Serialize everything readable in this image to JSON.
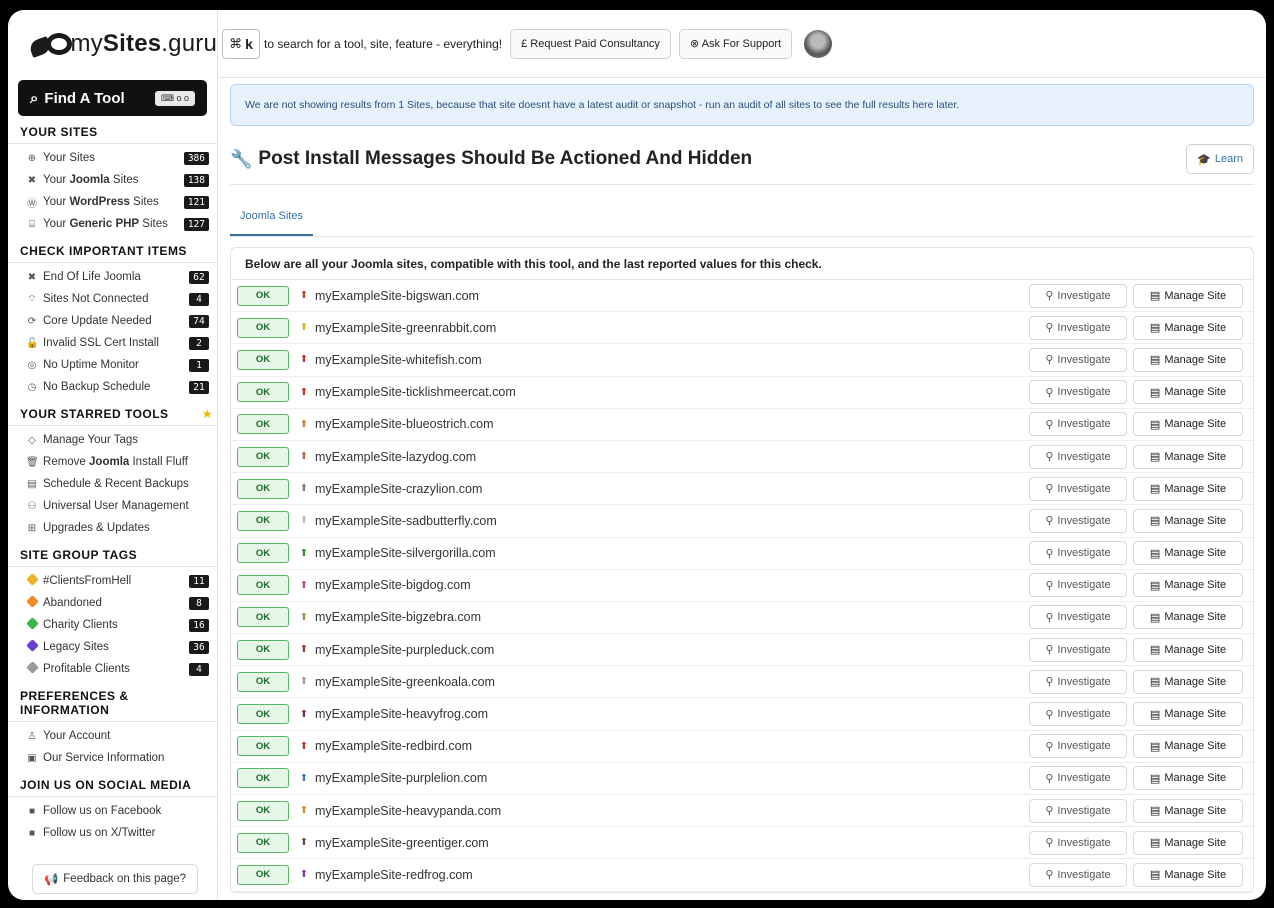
{
  "brand": {
    "name_prefix": "my",
    "name_bold": "Sites",
    "name_suffix": ".guru"
  },
  "sidebar": {
    "find_tool": {
      "label": "Find A Tool",
      "shortcut": "⌨ o o"
    },
    "sections": [
      {
        "title": "YOUR SITES",
        "items": [
          {
            "icon": "globe-icon",
            "glyph": "⊕",
            "pre": "Your Sites",
            "bold": "",
            "post": "",
            "count": "386"
          },
          {
            "icon": "joomla-icon",
            "glyph": "✖",
            "pre": "Your ",
            "bold": "Joomla",
            "post": " Sites",
            "count": "138"
          },
          {
            "icon": "wordpress-icon",
            "glyph": "Ⓦ",
            "pre": "Your ",
            "bold": "WordPress",
            "post": " Sites",
            "count": "121"
          },
          {
            "icon": "php-icon",
            "glyph": "⌸",
            "pre": "Your ",
            "bold": "Generic PHP",
            "post": " Sites",
            "count": "127"
          }
        ]
      },
      {
        "title": "CHECK IMPORTANT ITEMS",
        "items": [
          {
            "icon": "joomla-icon",
            "glyph": "✖",
            "pre": "End Of Life Joomla",
            "bold": "",
            "post": "",
            "count": "62"
          },
          {
            "icon": "wifi-off-icon",
            "glyph": "⌔",
            "pre": "Sites Not Connected",
            "bold": "",
            "post": "",
            "count": "4"
          },
          {
            "icon": "update-icon",
            "glyph": "⟳",
            "pre": "Core Update Needed",
            "bold": "",
            "post": "",
            "count": "74"
          },
          {
            "icon": "lock-icon",
            "glyph": "🔓",
            "pre": "Invalid SSL Cert Install",
            "bold": "",
            "post": "",
            "count": "2"
          },
          {
            "icon": "monitor-icon",
            "glyph": "◎",
            "pre": "No Uptime Monitor",
            "bold": "",
            "post": "",
            "count": "1"
          },
          {
            "icon": "clock-icon",
            "glyph": "◷",
            "pre": "No Backup Schedule",
            "bold": "",
            "post": "",
            "count": "21"
          }
        ]
      },
      {
        "title": "YOUR STARRED TOOLS",
        "star": true,
        "items": [
          {
            "icon": "tag-icon",
            "glyph": "◇",
            "pre": "Manage Your Tags",
            "bold": "",
            "post": "",
            "count": ""
          },
          {
            "icon": "trash-icon",
            "glyph": "🗑",
            "pre": "Remove ",
            "bold": "Joomla",
            "post": " Install Fluff",
            "count": ""
          },
          {
            "icon": "database-icon",
            "glyph": "▤",
            "pre": "Schedule & Recent Backups",
            "bold": "",
            "post": "",
            "count": ""
          },
          {
            "icon": "users-icon",
            "glyph": "⚇",
            "pre": "Universal User Management",
            "bold": "",
            "post": "",
            "count": ""
          },
          {
            "icon": "sitemap-icon",
            "glyph": "⊞",
            "pre": "Upgrades & Updates",
            "bold": "",
            "post": "",
            "count": ""
          }
        ]
      },
      {
        "title": "SITE GROUP TAGS",
        "items": [
          {
            "icon": "tag-icon",
            "tag_color": "#e8b62a",
            "pre": "#ClientsFromHell",
            "bold": "",
            "post": "",
            "count": "11"
          },
          {
            "icon": "tag-icon",
            "tag_color": "#f08a24",
            "pre": "Abandoned",
            "bold": "",
            "post": "",
            "count": "8"
          },
          {
            "icon": "tag-icon",
            "tag_color": "#3db54a",
            "pre": "Charity Clients",
            "bold": "",
            "post": "",
            "count": "16"
          },
          {
            "icon": "tag-icon",
            "tag_color": "#6a3fd0",
            "pre": "Legacy Sites",
            "bold": "",
            "post": "",
            "count": "36"
          },
          {
            "icon": "tag-icon",
            "tag_color": "#9a9a9a",
            "pre": "Profitable Clients",
            "bold": "",
            "post": "",
            "count": "4"
          }
        ]
      },
      {
        "title": "PREFERENCES & INFORMATION",
        "items": [
          {
            "icon": "user-icon",
            "glyph": "♙",
            "pre": "Your Account",
            "bold": "",
            "post": "",
            "count": ""
          },
          {
            "icon": "info-icon",
            "glyph": "▣",
            "pre": "Our Service Information",
            "bold": "",
            "post": "",
            "count": ""
          }
        ]
      },
      {
        "title": "JOIN US ON SOCIAL MEDIA",
        "items": [
          {
            "icon": "facebook-icon",
            "glyph": "■",
            "pre": "Follow us on Facebook",
            "bold": "",
            "post": "",
            "count": ""
          },
          {
            "icon": "x-twitter-icon",
            "glyph": "■",
            "pre": "Follow us on X/Twitter",
            "bold": "",
            "post": "",
            "count": ""
          }
        ]
      }
    ],
    "feedback_label": "Feedback on this page?"
  },
  "topbar": {
    "shortcut_symbol": "⌘",
    "shortcut_key": "k",
    "search_text": "to search for a tool, site, feature - everything!",
    "consultancy_label": "£ Request Paid Consultancy",
    "support_label": "⊗ Ask For Support"
  },
  "main": {
    "notice": "We are not showing results from 1 Sites, because that site doesnt have a latest audit or snapshot - run an audit of all sites to see the full results here later.",
    "title": "Post Install Messages Should Be Actioned And Hidden",
    "learn_label": "Learn",
    "tab_label": "Joomla Sites",
    "table_heading": "Below are all your Joomla sites, compatible with this tool, and the last reported values for this check.",
    "status_label": "OK",
    "investigate_label": "Investigate",
    "manage_label": "Manage Site",
    "sites": [
      {
        "name": "myExampleSite-bigswan.com",
        "pin_color": "#b0452a"
      },
      {
        "name": "myExampleSite-greenrabbit.com",
        "pin_color": "#d4b21c"
      },
      {
        "name": "myExampleSite-whitefish.com",
        "pin_color": "#c4302b"
      },
      {
        "name": "myExampleSite-ticklishmeercat.com",
        "pin_color": "#c4302b"
      },
      {
        "name": "myExampleSite-blueostrich.com",
        "pin_color": "#c87a2a"
      },
      {
        "name": "myExampleSite-lazydog.com",
        "pin_color": "#a86a4a"
      },
      {
        "name": "myExampleSite-crazylion.com",
        "pin_color": "#8a7a6a"
      },
      {
        "name": "myExampleSite-sadbutterfly.com",
        "pin_color": "#c8b8a8"
      },
      {
        "name": "myExampleSite-silvergorilla.com",
        "pin_color": "#3a8a3a"
      },
      {
        "name": "myExampleSite-bigdog.com",
        "pin_color": "#c44a6a"
      },
      {
        "name": "myExampleSite-bigzebra.com",
        "pin_color": "#a88a5a"
      },
      {
        "name": "myExampleSite-purpleduck.com",
        "pin_color": "#8a3a2a"
      },
      {
        "name": "myExampleSite-greenkoala.com",
        "pin_color": "#a89a8a"
      },
      {
        "name": "myExampleSite-heavyfrog.com",
        "pin_color": "#7a2a5a"
      },
      {
        "name": "myExampleSite-redbird.com",
        "pin_color": "#c4302b"
      },
      {
        "name": "myExampleSite-purplelion.com",
        "pin_color": "#3a7ab8"
      },
      {
        "name": "myExampleSite-heavypanda.com",
        "pin_color": "#d48a2a"
      },
      {
        "name": "myExampleSite-greentiger.com",
        "pin_color": "#6a4a3a"
      },
      {
        "name": "myExampleSite-redfrog.com",
        "pin_color": "#8a3aa8"
      }
    ]
  }
}
